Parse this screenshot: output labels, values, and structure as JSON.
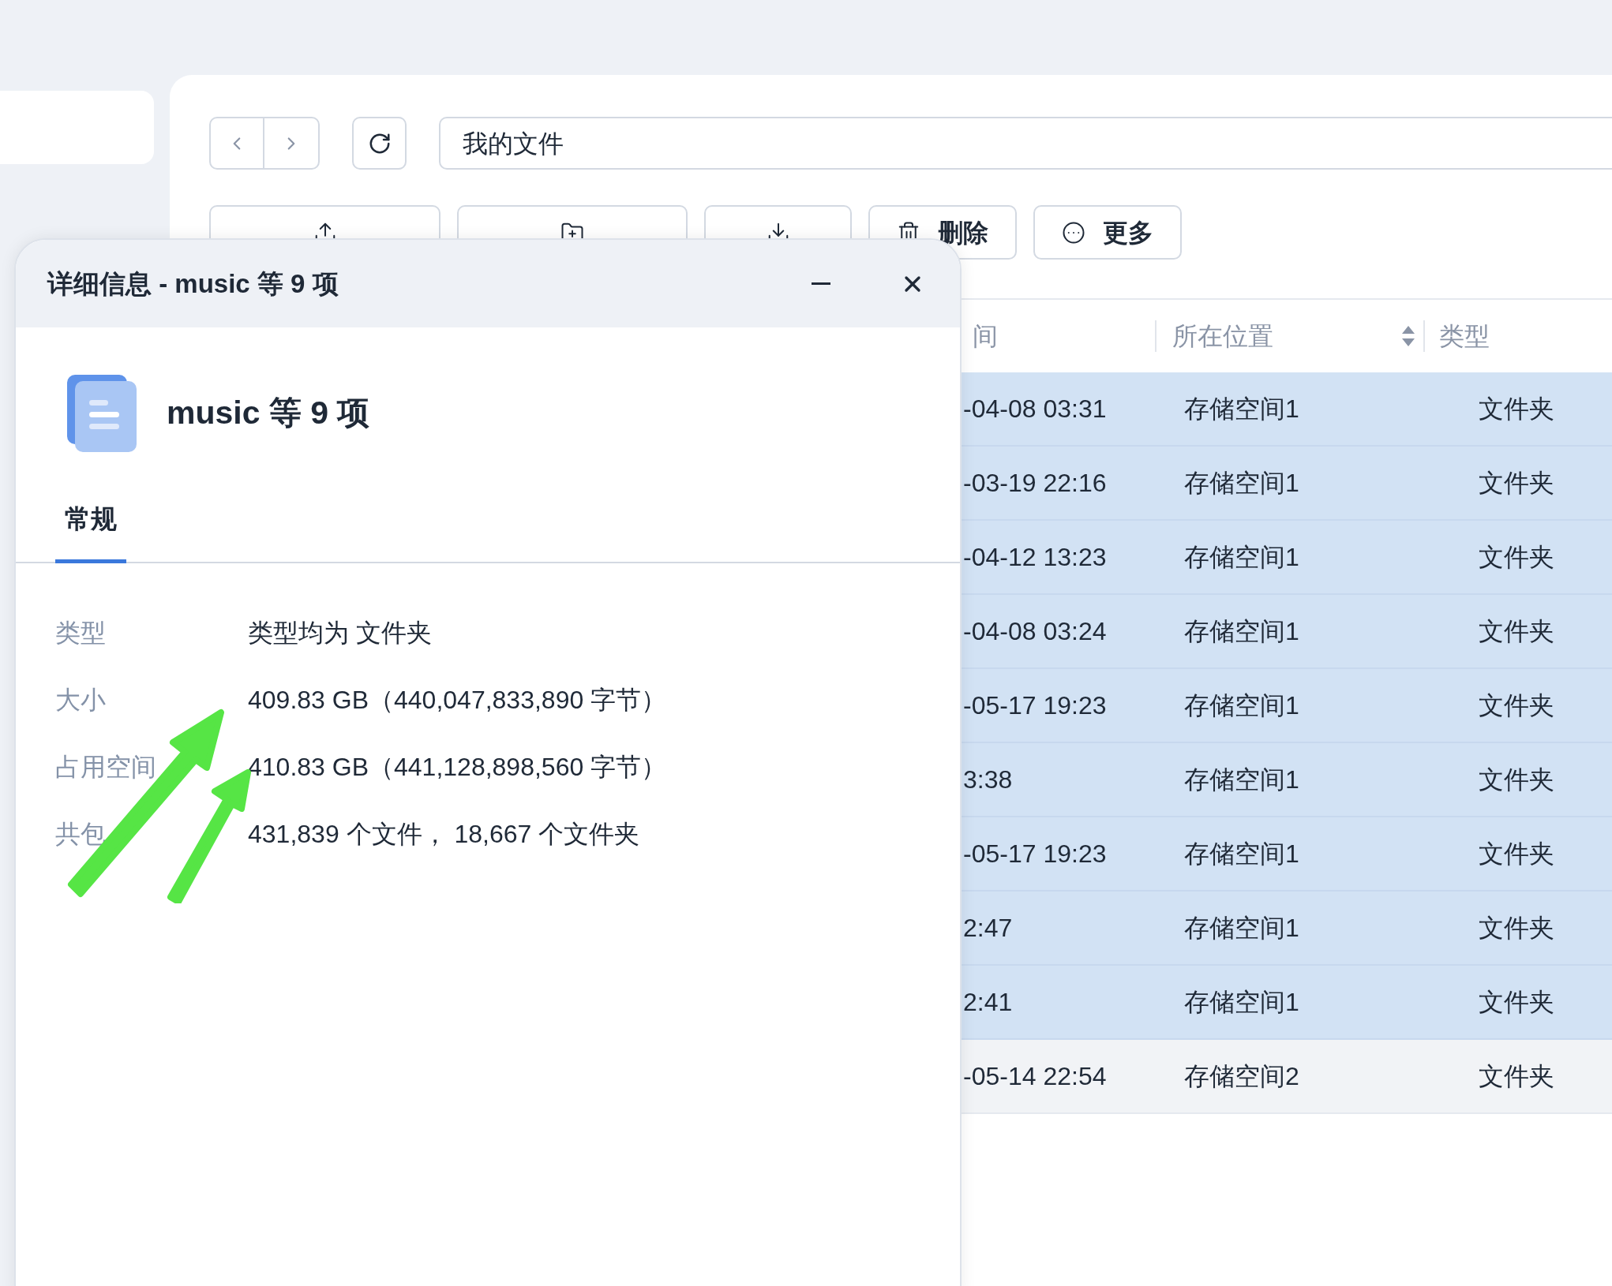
{
  "nav": {
    "path": "我的文件"
  },
  "toolbar": [
    {
      "kind": "upload"
    },
    {
      "kind": "new-folder"
    },
    {
      "kind": "download"
    },
    {
      "kind": "delete",
      "label": "删除"
    },
    {
      "kind": "more",
      "label": "更多"
    }
  ],
  "table": {
    "columns": [
      "间",
      "所在位置",
      "类型"
    ],
    "rows": [
      {
        "column_1": "-04-08 03:31",
        "location": "存储空间1",
        "type": "文件夹",
        "selected": true
      },
      {
        "column_1": "-03-19 22:16",
        "location": "存储空间1",
        "type": "文件夹",
        "selected": true
      },
      {
        "column_1": "-04-12 13:23",
        "location": "存储空间1",
        "type": "文件夹",
        "selected": true
      },
      {
        "column_1": "-04-08 03:24",
        "location": "存储空间1",
        "type": "文件夹",
        "selected": true
      },
      {
        "column_1": "-05-17 19:23",
        "location": "存储空间1",
        "type": "文件夹",
        "selected": true
      },
      {
        "column_1": "3:38",
        "location": "存储空间1",
        "type": "文件夹",
        "selected": true
      },
      {
        "column_1": "-05-17 19:23",
        "location": "存储空间1",
        "type": "文件夹",
        "selected": true
      },
      {
        "column_1": "2:47",
        "location": "存储空间1",
        "type": "文件夹",
        "selected": true
      },
      {
        "column_1": "2:41",
        "location": "存储空间1",
        "type": "文件夹",
        "selected": true
      },
      {
        "column_1": "-05-14 22:54",
        "location": "存储空间2",
        "type": "文件夹",
        "selected": false
      }
    ]
  },
  "dialog": {
    "title": "详细信息 - music 等 9 项",
    "name": "music 等 9 项",
    "tabs": [
      {
        "label": "常规",
        "selected": true
      }
    ],
    "properties": [
      {
        "label": "类型",
        "value": "类型均为 文件夹"
      },
      {
        "label": "大小",
        "value": "409.83 GB（440,047,833,890 字节）"
      },
      {
        "label": "占用空间",
        "value": "410.83 GB（441,128,898,560 字节）"
      },
      {
        "label": "共包",
        "value": "431,839 个文件， 18,667 个文件夹"
      }
    ]
  }
}
